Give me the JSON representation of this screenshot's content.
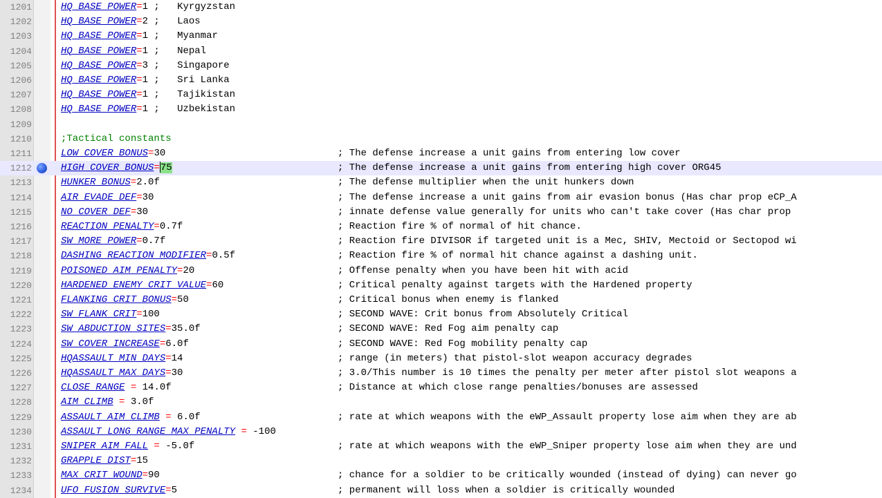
{
  "editor": {
    "bookmark_line": "1212",
    "current_line": "1212",
    "accent_colors": {
      "key": "#0000c0",
      "operator": "#ff0000",
      "section_comment": "#008000",
      "fold_line": "#e05050",
      "selection": "#8be28b",
      "bookmark": "#2f5fe0"
    }
  },
  "lines": [
    {
      "num": "1201",
      "key": "HQ_BASE_POWER",
      "op": "=",
      "value": "1",
      "semi": " ;",
      "country": "Kyrgyzstan"
    },
    {
      "num": "1202",
      "key": "HQ_BASE_POWER",
      "op": "=",
      "value": "2",
      "semi": " ;",
      "country": "Laos"
    },
    {
      "num": "1203",
      "key": "HQ_BASE_POWER",
      "op": "=",
      "value": "1",
      "semi": " ;",
      "country": "Myanmar"
    },
    {
      "num": "1204",
      "key": "HQ_BASE_POWER",
      "op": "=",
      "value": "1",
      "semi": " ;",
      "country": "Nepal"
    },
    {
      "num": "1205",
      "key": "HQ_BASE_POWER",
      "op": "=",
      "value": "3",
      "semi": " ;",
      "country": "Singapore"
    },
    {
      "num": "1206",
      "key": "HQ_BASE_POWER",
      "op": "=",
      "value": "1",
      "semi": " ;",
      "country": "Sri Lanka"
    },
    {
      "num": "1207",
      "key": "HQ_BASE_POWER",
      "op": "=",
      "value": "1",
      "semi": " ;",
      "country": "Tajikistan"
    },
    {
      "num": "1208",
      "key": "HQ_BASE_POWER",
      "op": "=",
      "value": "1",
      "semi": " ;",
      "country": "Uzbekistan"
    },
    {
      "num": "1209"
    },
    {
      "num": "1210",
      "section": ";Tactical constants"
    },
    {
      "num": "1211",
      "key": "LOW_COVER_BONUS",
      "op": "=",
      "value": "30",
      "comment": "; The defense increase a unit gains from entering low cover"
    },
    {
      "num": "1212",
      "key": "HIGH_COVER_BONUS",
      "op": "=",
      "value": "75",
      "comment": "; The defense increase a unit gains from entering high cover ORG45"
    },
    {
      "num": "1213",
      "key": "HUNKER_BONUS",
      "op": "=",
      "value": "2.0f",
      "comment": "; The defense multiplier when the unit hunkers down"
    },
    {
      "num": "1214",
      "key": "AIR_EVADE_DEF",
      "op": "=",
      "value": "30",
      "comment": "; The defense increase a unit gains from air evasion bonus (Has char prop eCP_A"
    },
    {
      "num": "1215",
      "key": "NO_COVER_DEF",
      "op": "=",
      "value": "30",
      "comment": "; innate defense value generally for units who can't take cover (Has char prop"
    },
    {
      "num": "1216",
      "key": "REACTION_PENALTY",
      "op": "=",
      "value": "0.7f",
      "comment": "; Reaction fire % of normal of hit chance."
    },
    {
      "num": "1217",
      "key": "SW_MORE_POWER",
      "op": "=",
      "value": "0.7f",
      "comment": "; Reaction fire DIVISOR if targeted unit is a Mec, SHIV, Mectoid or Sectopod wi"
    },
    {
      "num": "1218",
      "key": "DASHING_REACTION_MODIFIER",
      "op": "=",
      "value": "0.5f",
      "comment": "; Reaction fire % of normal hit chance against a dashing unit."
    },
    {
      "num": "1219",
      "key": "POISONED_AIM_PENALTY",
      "op": "=",
      "value": "20",
      "comment": "; Offense penalty when you have been hit with acid"
    },
    {
      "num": "1220",
      "key": "HARDENED_ENEMY_CRIT_VALUE",
      "op": "=",
      "value": "60",
      "comment": "; Critical penalty against targets with the Hardened property"
    },
    {
      "num": "1221",
      "key": "FLANKING_CRIT_BONUS",
      "op": "=",
      "value": "50",
      "comment": "; Critical bonus when enemy is flanked"
    },
    {
      "num": "1222",
      "key": "SW_FLANK_CRIT",
      "op": "=",
      "value": "100",
      "comment": "; SECOND WAVE: Crit bonus from Absolutely Critical"
    },
    {
      "num": "1223",
      "key": "SW_ABDUCTION_SITES",
      "op": "=",
      "value": "35.0f",
      "comment": "; SECOND WAVE: Red Fog aim penalty cap"
    },
    {
      "num": "1224",
      "key": "SW_COVER_INCREASE",
      "op": "=",
      "value": "6.0f",
      "comment": "; SECOND WAVE: Red Fog mobility penalty cap"
    },
    {
      "num": "1225",
      "key": "HQASSAULT_MIN_DAYS",
      "op": "=",
      "value": "14",
      "comment": "; range (in meters) that pistol-slot weapon accuracy degrades"
    },
    {
      "num": "1226",
      "key": "HQASSAULT_MAX_DAYS",
      "op": "=",
      "value": "30",
      "comment": "; 3.0/This number is 10 times the penalty per meter after pistol slot weapons a"
    },
    {
      "num": "1227",
      "key": "CLOSE_RANGE",
      "op": " = ",
      "value": "14.0f",
      "comment": "; Distance at which close range penalties/bonuses are assessed"
    },
    {
      "num": "1228",
      "key": "AIM_CLIMB",
      "op": " = ",
      "value": "3.0f"
    },
    {
      "num": "1229",
      "key": "ASSAULT_AIM_CLIMB",
      "op": " = ",
      "value": "6.0f",
      "comment": "; rate at which weapons with the eWP_Assault property lose aim when they are ab"
    },
    {
      "num": "1230",
      "key": "ASSAULT_LONG_RANGE_MAX_PENALTY",
      "op": " = ",
      "value": "-100"
    },
    {
      "num": "1231",
      "key": "SNIPER_AIM_FALL",
      "op": " = ",
      "value": "-5.0f",
      "comment": "; rate at which weapons with the eWP_Sniper property lose aim when they are und"
    },
    {
      "num": "1232",
      "key": "GRAPPLE_DIST",
      "op": "=",
      "value": "15"
    },
    {
      "num": "1233",
      "key": "MAX_CRIT_WOUND",
      "op": "=",
      "value": "90",
      "comment": "; chance for a soldier to be critically wounded (instead of dying) can never go"
    },
    {
      "num": "1234",
      "key": "UFO_FUSION_SURVIVE",
      "op": "=",
      "value": "5",
      "comment": "; permanent will loss when a soldier is critically wounded"
    }
  ]
}
